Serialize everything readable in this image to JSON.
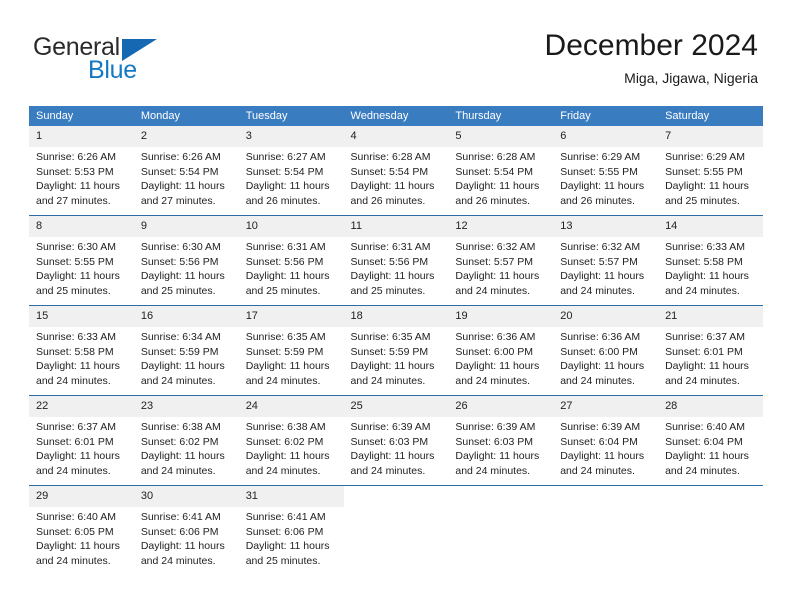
{
  "brand": {
    "name_part1": "General",
    "name_part2": "Blue",
    "logo_icon": "triangle-logo-icon"
  },
  "header": {
    "title": "December 2024",
    "subtitle": "Miga, Jigawa, Nigeria"
  },
  "theme": {
    "header_blue": "#3a7cc0",
    "row_divider_blue": "#2e6da4",
    "daynum_band": "#f0f0f0",
    "brand_blue": "#1479c4",
    "text": "#222222"
  },
  "weekday_headers": [
    "Sunday",
    "Monday",
    "Tuesday",
    "Wednesday",
    "Thursday",
    "Friday",
    "Saturday"
  ],
  "weeks": [
    [
      {
        "day": "1",
        "sunrise": "Sunrise: 6:26 AM",
        "sunset": "Sunset: 5:53 PM",
        "daylight_line1": "Daylight: 11 hours",
        "daylight_line2": "and 27 minutes."
      },
      {
        "day": "2",
        "sunrise": "Sunrise: 6:26 AM",
        "sunset": "Sunset: 5:54 PM",
        "daylight_line1": "Daylight: 11 hours",
        "daylight_line2": "and 27 minutes."
      },
      {
        "day": "3",
        "sunrise": "Sunrise: 6:27 AM",
        "sunset": "Sunset: 5:54 PM",
        "daylight_line1": "Daylight: 11 hours",
        "daylight_line2": "and 26 minutes."
      },
      {
        "day": "4",
        "sunrise": "Sunrise: 6:28 AM",
        "sunset": "Sunset: 5:54 PM",
        "daylight_line1": "Daylight: 11 hours",
        "daylight_line2": "and 26 minutes."
      },
      {
        "day": "5",
        "sunrise": "Sunrise: 6:28 AM",
        "sunset": "Sunset: 5:54 PM",
        "daylight_line1": "Daylight: 11 hours",
        "daylight_line2": "and 26 minutes."
      },
      {
        "day": "6",
        "sunrise": "Sunrise: 6:29 AM",
        "sunset": "Sunset: 5:55 PM",
        "daylight_line1": "Daylight: 11 hours",
        "daylight_line2": "and 26 minutes."
      },
      {
        "day": "7",
        "sunrise": "Sunrise: 6:29 AM",
        "sunset": "Sunset: 5:55 PM",
        "daylight_line1": "Daylight: 11 hours",
        "daylight_line2": "and 25 minutes."
      }
    ],
    [
      {
        "day": "8",
        "sunrise": "Sunrise: 6:30 AM",
        "sunset": "Sunset: 5:55 PM",
        "daylight_line1": "Daylight: 11 hours",
        "daylight_line2": "and 25 minutes."
      },
      {
        "day": "9",
        "sunrise": "Sunrise: 6:30 AM",
        "sunset": "Sunset: 5:56 PM",
        "daylight_line1": "Daylight: 11 hours",
        "daylight_line2": "and 25 minutes."
      },
      {
        "day": "10",
        "sunrise": "Sunrise: 6:31 AM",
        "sunset": "Sunset: 5:56 PM",
        "daylight_line1": "Daylight: 11 hours",
        "daylight_line2": "and 25 minutes."
      },
      {
        "day": "11",
        "sunrise": "Sunrise: 6:31 AM",
        "sunset": "Sunset: 5:56 PM",
        "daylight_line1": "Daylight: 11 hours",
        "daylight_line2": "and 25 minutes."
      },
      {
        "day": "12",
        "sunrise": "Sunrise: 6:32 AM",
        "sunset": "Sunset: 5:57 PM",
        "daylight_line1": "Daylight: 11 hours",
        "daylight_line2": "and 24 minutes."
      },
      {
        "day": "13",
        "sunrise": "Sunrise: 6:32 AM",
        "sunset": "Sunset: 5:57 PM",
        "daylight_line1": "Daylight: 11 hours",
        "daylight_line2": "and 24 minutes."
      },
      {
        "day": "14",
        "sunrise": "Sunrise: 6:33 AM",
        "sunset": "Sunset: 5:58 PM",
        "daylight_line1": "Daylight: 11 hours",
        "daylight_line2": "and 24 minutes."
      }
    ],
    [
      {
        "day": "15",
        "sunrise": "Sunrise: 6:33 AM",
        "sunset": "Sunset: 5:58 PM",
        "daylight_line1": "Daylight: 11 hours",
        "daylight_line2": "and 24 minutes."
      },
      {
        "day": "16",
        "sunrise": "Sunrise: 6:34 AM",
        "sunset": "Sunset: 5:59 PM",
        "daylight_line1": "Daylight: 11 hours",
        "daylight_line2": "and 24 minutes."
      },
      {
        "day": "17",
        "sunrise": "Sunrise: 6:35 AM",
        "sunset": "Sunset: 5:59 PM",
        "daylight_line1": "Daylight: 11 hours",
        "daylight_line2": "and 24 minutes."
      },
      {
        "day": "18",
        "sunrise": "Sunrise: 6:35 AM",
        "sunset": "Sunset: 5:59 PM",
        "daylight_line1": "Daylight: 11 hours",
        "daylight_line2": "and 24 minutes."
      },
      {
        "day": "19",
        "sunrise": "Sunrise: 6:36 AM",
        "sunset": "Sunset: 6:00 PM",
        "daylight_line1": "Daylight: 11 hours",
        "daylight_line2": "and 24 minutes."
      },
      {
        "day": "20",
        "sunrise": "Sunrise: 6:36 AM",
        "sunset": "Sunset: 6:00 PM",
        "daylight_line1": "Daylight: 11 hours",
        "daylight_line2": "and 24 minutes."
      },
      {
        "day": "21",
        "sunrise": "Sunrise: 6:37 AM",
        "sunset": "Sunset: 6:01 PM",
        "daylight_line1": "Daylight: 11 hours",
        "daylight_line2": "and 24 minutes."
      }
    ],
    [
      {
        "day": "22",
        "sunrise": "Sunrise: 6:37 AM",
        "sunset": "Sunset: 6:01 PM",
        "daylight_line1": "Daylight: 11 hours",
        "daylight_line2": "and 24 minutes."
      },
      {
        "day": "23",
        "sunrise": "Sunrise: 6:38 AM",
        "sunset": "Sunset: 6:02 PM",
        "daylight_line1": "Daylight: 11 hours",
        "daylight_line2": "and 24 minutes."
      },
      {
        "day": "24",
        "sunrise": "Sunrise: 6:38 AM",
        "sunset": "Sunset: 6:02 PM",
        "daylight_line1": "Daylight: 11 hours",
        "daylight_line2": "and 24 minutes."
      },
      {
        "day": "25",
        "sunrise": "Sunrise: 6:39 AM",
        "sunset": "Sunset: 6:03 PM",
        "daylight_line1": "Daylight: 11 hours",
        "daylight_line2": "and 24 minutes."
      },
      {
        "day": "26",
        "sunrise": "Sunrise: 6:39 AM",
        "sunset": "Sunset: 6:03 PM",
        "daylight_line1": "Daylight: 11 hours",
        "daylight_line2": "and 24 minutes."
      },
      {
        "day": "27",
        "sunrise": "Sunrise: 6:39 AM",
        "sunset": "Sunset: 6:04 PM",
        "daylight_line1": "Daylight: 11 hours",
        "daylight_line2": "and 24 minutes."
      },
      {
        "day": "28",
        "sunrise": "Sunrise: 6:40 AM",
        "sunset": "Sunset: 6:04 PM",
        "daylight_line1": "Daylight: 11 hours",
        "daylight_line2": "and 24 minutes."
      }
    ],
    [
      {
        "day": "29",
        "sunrise": "Sunrise: 6:40 AM",
        "sunset": "Sunset: 6:05 PM",
        "daylight_line1": "Daylight: 11 hours",
        "daylight_line2": "and 24 minutes."
      },
      {
        "day": "30",
        "sunrise": "Sunrise: 6:41 AM",
        "sunset": "Sunset: 6:06 PM",
        "daylight_line1": "Daylight: 11 hours",
        "daylight_line2": "and 24 minutes."
      },
      {
        "day": "31",
        "sunrise": "Sunrise: 6:41 AM",
        "sunset": "Sunset: 6:06 PM",
        "daylight_line1": "Daylight: 11 hours",
        "daylight_line2": "and 25 minutes."
      },
      {
        "day": "",
        "sunrise": "",
        "sunset": "",
        "daylight_line1": "",
        "daylight_line2": ""
      },
      {
        "day": "",
        "sunrise": "",
        "sunset": "",
        "daylight_line1": "",
        "daylight_line2": ""
      },
      {
        "day": "",
        "sunrise": "",
        "sunset": "",
        "daylight_line1": "",
        "daylight_line2": ""
      },
      {
        "day": "",
        "sunrise": "",
        "sunset": "",
        "daylight_line1": "",
        "daylight_line2": ""
      }
    ]
  ]
}
